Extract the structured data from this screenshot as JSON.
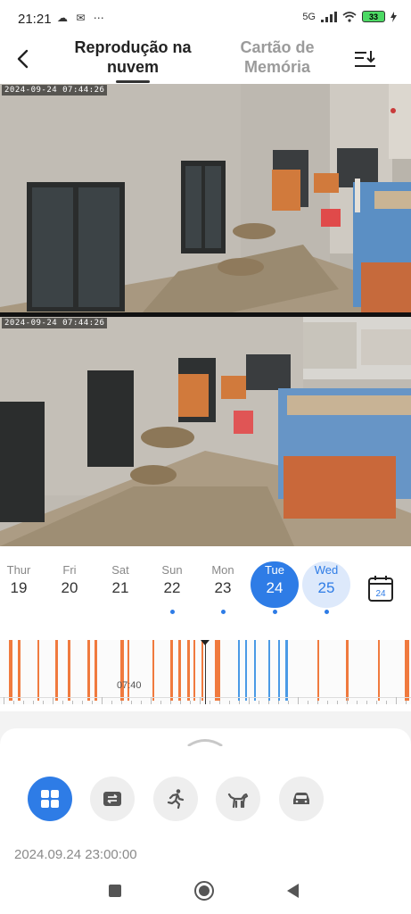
{
  "status_bar": {
    "time": "21:21",
    "left_icons": "☁ ✉ ⋯",
    "network": "5G",
    "battery": "33"
  },
  "header": {
    "back_icon": "chevron-left-icon",
    "tabs": [
      {
        "label": "Reprodução na nuvem",
        "active": true
      },
      {
        "label": "Cartão de Memória",
        "active": false
      }
    ],
    "sort_icon": "sort-download-icon"
  },
  "cameras": [
    {
      "timestamp": "2024-09-24  07:44:26"
    },
    {
      "timestamp": "2024-09-24  07:44:26"
    }
  ],
  "date_strip": {
    "days": [
      {
        "name": "Thur",
        "num": "19",
        "has_dot": false,
        "state": "normal"
      },
      {
        "name": "Fri",
        "num": "20",
        "has_dot": false,
        "state": "normal"
      },
      {
        "name": "Sat",
        "num": "21",
        "has_dot": false,
        "state": "normal"
      },
      {
        "name": "Sun",
        "num": "22",
        "has_dot": true,
        "state": "normal"
      },
      {
        "name": "Mon",
        "num": "23",
        "has_dot": true,
        "state": "normal"
      },
      {
        "name": "Tue",
        "num": "24",
        "has_dot": true,
        "state": "selected"
      },
      {
        "name": "Wed",
        "num": "25",
        "has_dot": true,
        "state": "next"
      }
    ],
    "calendar_day": "24"
  },
  "timeline": {
    "cursor_label": "07:40",
    "event_color": "#f07a3e",
    "motion_color": "#4a9ae6"
  },
  "bottom_sheet": {
    "tools": [
      {
        "icon": "grid-icon",
        "active": true
      },
      {
        "icon": "swap-icon",
        "active": false
      },
      {
        "icon": "person-running-icon",
        "active": false
      },
      {
        "icon": "pet-icon",
        "active": false
      },
      {
        "icon": "car-icon",
        "active": false
      }
    ],
    "timestamp": "2024.09.24 23:00:00"
  },
  "colors": {
    "accent": "#2e7ce6",
    "accent_light": "#dde9fb"
  }
}
